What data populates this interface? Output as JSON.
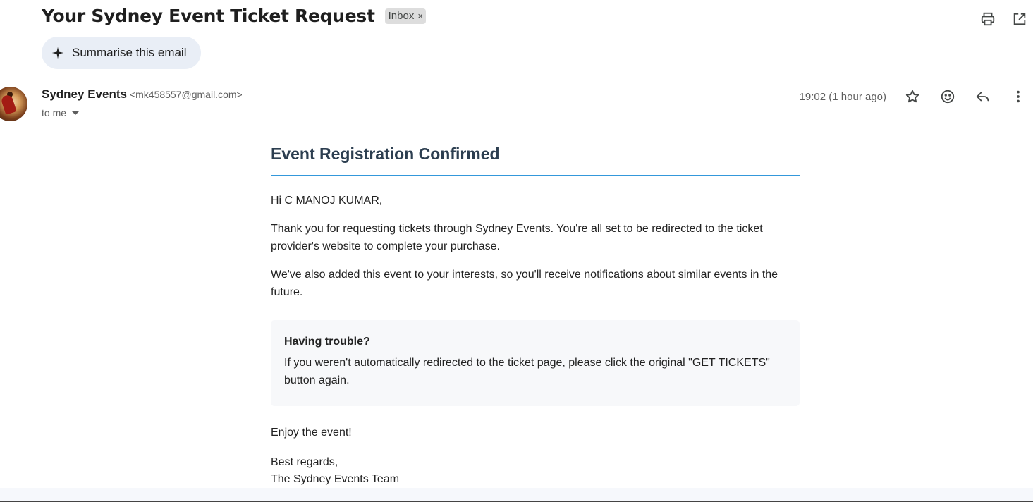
{
  "header": {
    "subject": "Your Sydney Event Ticket Request",
    "label": "Inbox",
    "label_remove": "×",
    "icons": [
      "print-icon",
      "open-in-new-window-icon"
    ]
  },
  "summarise": {
    "label": "Summarise this email",
    "icon": "sparkle-icon"
  },
  "message": {
    "sender_name": "Sydney Events",
    "sender_email": "<mk458557@gmail.com>",
    "to": "to me",
    "timestamp": "19:02 (1 hour ago)",
    "actions": [
      "star-icon",
      "emoji-reaction-icon",
      "reply-icon",
      "more-options-icon"
    ]
  },
  "email": {
    "title": "Event Registration Confirmed",
    "greeting": "Hi C MANOJ KUMAR,",
    "para1": "Thank you for requesting tickets through Sydney Events. You're all set to be redirected to the ticket provider's website to complete your purchase.",
    "para2": "We've also added this event to your interests, so you'll receive notifications about similar events in the future.",
    "trouble_title": "Having trouble?",
    "trouble_text": "If you weren't automatically redirected to the ticket page, please click the original \"GET TICKETS\" button again.",
    "enjoy": "Enjoy the event!",
    "regards": "Best regards,",
    "signature": "The Sydney Events Team"
  },
  "colors": {
    "title": "#2c3e50",
    "title_rule": "#3498db",
    "summarise_bg": "#e9eef6",
    "trouble_bg": "#f7f8fa",
    "label_bg": "#dddddd"
  }
}
